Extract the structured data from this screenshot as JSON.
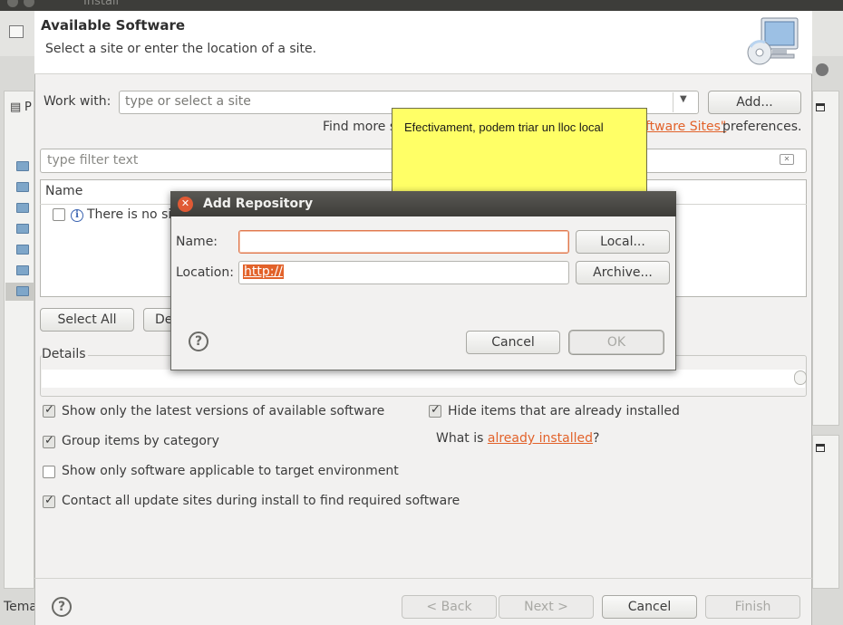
{
  "background": {
    "window_title": "Install",
    "bottom_text": "Tema"
  },
  "header": {
    "title": "Available Software",
    "subtitle": "Select a site or enter the location of a site."
  },
  "work_with": {
    "label": "Work with:",
    "placeholder": "type or select a site",
    "add_button": "Add..."
  },
  "find_more": {
    "prefix": "Find more s",
    "link": "ftware Sites\"",
    "suffix": " preferences."
  },
  "filter": {
    "placeholder": "type filter text"
  },
  "table": {
    "column_name": "Name",
    "row_text": "There is no sit"
  },
  "selection_buttons": {
    "select_all": "Select All",
    "deselect_partial": "De"
  },
  "details": {
    "label": "Details"
  },
  "options": {
    "latest_versions": {
      "label": "Show only the latest versions of available software",
      "checked": true
    },
    "group_by_category": {
      "label": "Group items by category",
      "checked": true
    },
    "target_env": {
      "label": "Show only software applicable to target environment",
      "checked": false
    },
    "contact_all": {
      "label": "Contact all update sites during install to find required software",
      "checked": true
    },
    "hide_installed": {
      "label": "Hide items that are already installed",
      "checked": true
    },
    "what_is_prefix": "What is ",
    "what_is_link": "already installed",
    "what_is_suffix": "?"
  },
  "footer": {
    "back": "< Back",
    "next": "Next >",
    "cancel": "Cancel",
    "finish": "Finish"
  },
  "callout": {
    "text": "Efectivament, podem triar un lloc local"
  },
  "add_repository": {
    "title": "Add Repository",
    "name_label": "Name:",
    "name_value": "",
    "location_label": "Location:",
    "location_value": "http://",
    "local_button": "Local...",
    "archive_button": "Archive...",
    "cancel_button": "Cancel",
    "ok_button": "OK"
  },
  "colors": {
    "accent_link": "#e2622a",
    "callout_fill": "#ffff66",
    "close_button": "#e05a35"
  }
}
